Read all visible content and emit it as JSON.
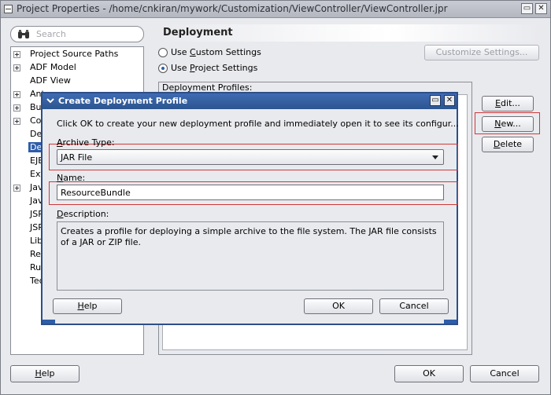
{
  "window": {
    "title": "Project Properties - /home/cnkiran/mywork/Customization/ViewController/ViewController.jpr",
    "restore_glyph": "▭",
    "close_glyph": "✕"
  },
  "search": {
    "placeholder": "Search",
    "icon": "binoculars-icon"
  },
  "tree": {
    "items": [
      {
        "label": "Project Source Paths",
        "expandable": true
      },
      {
        "label": "ADF Model",
        "expandable": true
      },
      {
        "label": "ADF View",
        "expandable": false
      },
      {
        "label": "Ant",
        "expandable": true
      },
      {
        "label": "Bus",
        "expandable": true
      },
      {
        "label": "Co",
        "expandable": true
      },
      {
        "label": "De",
        "expandable": false
      },
      {
        "label": "De",
        "expandable": false,
        "selected": true
      },
      {
        "label": "EJB",
        "expandable": false
      },
      {
        "label": "Ext",
        "expandable": false
      },
      {
        "label": "Jav",
        "expandable": true
      },
      {
        "label": "Jav",
        "expandable": false
      },
      {
        "label": "JSP",
        "expandable": false
      },
      {
        "label": "JSP",
        "expandable": false
      },
      {
        "label": "Libi",
        "expandable": false
      },
      {
        "label": "Res",
        "expandable": false
      },
      {
        "label": "Ru",
        "expandable": false
      },
      {
        "label": "Tec",
        "expandable": false
      }
    ]
  },
  "deployment": {
    "title": "Deployment",
    "use_custom_settings": {
      "pre": "Use ",
      "mnemonic": "C",
      "post": "ustom Settings"
    },
    "use_project_settings": {
      "pre": "Use ",
      "mnemonic": "P",
      "post": "roject Settings"
    },
    "selected_setting": "project",
    "customize_button": "Customize Settings...",
    "profiles_label": "Deployment Profiles:",
    "edit_button": {
      "mnemonic": "E",
      "post": "dit..."
    },
    "new_button": {
      "mnemonic": "N",
      "post": "ew..."
    },
    "delete_button": {
      "mnemonic": "D",
      "post": "elete"
    }
  },
  "dialog": {
    "title": "Create Deployment Profile",
    "description": "Click OK to create your new deployment profile and immediately open it to see its configur...",
    "archive_type_label": {
      "pre": "",
      "mnemonic": "A",
      "post": "rchive Type:"
    },
    "archive_type_value": "JAR File",
    "name_label": {
      "mnemonic": "N",
      "post": "ame:"
    },
    "name_value": "ResourceBundle",
    "description_label": {
      "pre": "",
      "mnemonic": "D",
      "post": "escription:"
    },
    "description_text": "Creates a profile for deploying a simple archive to the file system. The JAR file consists of a JAR or ZIP file.",
    "help_button": {
      "mnemonic": "H",
      "post": "elp"
    },
    "ok_button": "OK",
    "cancel_button": "Cancel",
    "restore_glyph": "▭",
    "close_glyph": "✕"
  },
  "footer": {
    "help_button": {
      "mnemonic": "H",
      "post": "elp"
    },
    "ok_button": "OK",
    "cancel_button": "Cancel"
  },
  "colors": {
    "selection": "#2f5da8",
    "highlight_box": "#d03838",
    "dialog_titlebar": "#2c558f"
  }
}
